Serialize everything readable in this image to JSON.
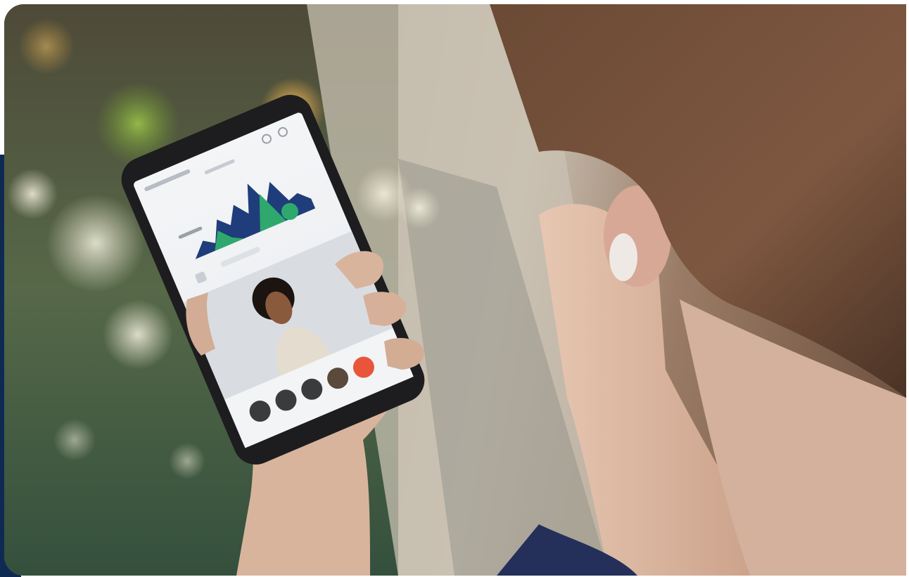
{
  "image": {
    "alt": "",
    "colors": {
      "accent_navy": "#0f2a52",
      "chart_dark_blue": "#1f3d7a",
      "chart_green": "#2fa86e",
      "call_end_red": "#e8553a"
    }
  },
  "phone_screen": {
    "call_controls": [
      "mute-icon",
      "video-icon",
      "speaker-icon",
      "more-icon",
      "end-call-icon"
    ]
  }
}
